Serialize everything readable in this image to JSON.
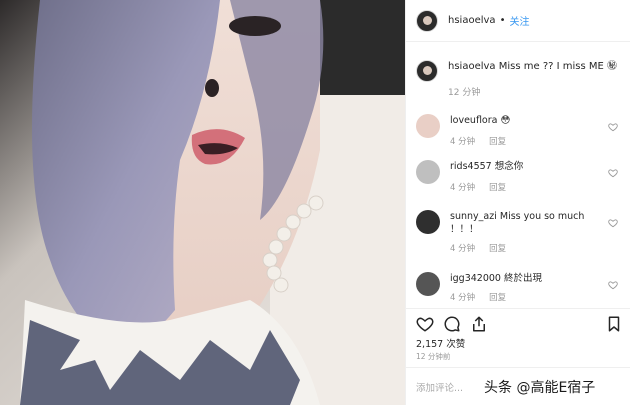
{
  "post": {
    "author": "hsiaoelva",
    "separator": "•",
    "follow_label": "关注",
    "caption_author": "hsiaoelva",
    "caption_text": "Miss me ?? I miss ME",
    "caption_emoji": "㊙",
    "caption_time": "12 分钟"
  },
  "comments": [
    {
      "user": "loveuflora",
      "text": "😳",
      "time": "4 分钟",
      "reply": "回复",
      "avatar_color": "#e9cfc6"
    },
    {
      "user": "rids4557",
      "text": "想念你",
      "time": "4 分钟",
      "reply": "回复",
      "avatar_color": "#bfbfbf"
    },
    {
      "user": "sunny_azi",
      "text": "Miss you so much ！！！",
      "time": "4 分钟",
      "reply": "回复",
      "avatar_color": "#2f2f2f"
    },
    {
      "user": "igg342000",
      "text": "終於出現",
      "time": "4 分钟",
      "reply": "回复",
      "avatar_color": "#555555"
    }
  ],
  "actions": {
    "like_icon": "heart-outline-icon",
    "comment_icon": "comment-bubble-icon",
    "share_icon": "share-upload-icon",
    "save_icon": "bookmark-icon"
  },
  "stats": {
    "likes": "2,157 次赞",
    "posted": "12 分钟前"
  },
  "composer": {
    "placeholder": "添加评论..."
  },
  "watermark": "头条 @高能E宿子",
  "colors": {
    "link": "#3897f0",
    "meta": "#999999",
    "border": "#efefef"
  }
}
